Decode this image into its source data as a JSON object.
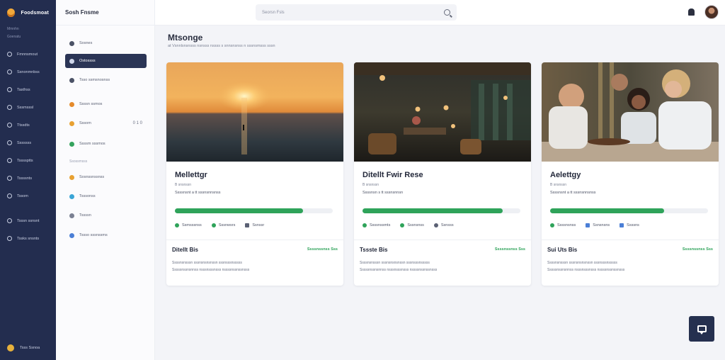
{
  "rail": {
    "brand": "Foodsmoat",
    "sub_lines": [
      "Mmnhn",
      "Goenatu"
    ],
    "items": [
      "Fmnnsmout",
      "Ssnonmnbss",
      "Tasthss",
      "Sssmsssl",
      "Ttssdts",
      "Sssssss",
      "Tssssptts",
      "Tssssnts",
      "Tssom",
      "Tsssn ssnsnt",
      "Tssks snsnts"
    ],
    "bottom": "Tsss Ssnoa"
  },
  "side": {
    "title": "Sosh Fnsme",
    "items": [
      {
        "label": "Sosnes",
        "color": "#4b5266"
      },
      {
        "label": "Ostossss",
        "color": "#cfd6ea",
        "active": true
      },
      {
        "label": "Tsso ssmsnosnss",
        "color": "#4b5266"
      },
      {
        "label": "Ssssn ssmos",
        "color": "#e58a2b"
      },
      {
        "label": "Sssom",
        "color": "#e8a132",
        "count": "0 1 0"
      },
      {
        "label": "Ssssm sssmos",
        "color": "#35a35e"
      }
    ],
    "section": "Ssossmsss",
    "section_items": [
      {
        "label": "Sosnssnssnss",
        "color": "#e8a132"
      },
      {
        "label": "Tsssonss",
        "color": "#3aa5d6"
      },
      {
        "label": "Tssssn",
        "color": "#7b8193"
      },
      {
        "label": "Tssso sssnssms",
        "color": "#4b7fd6"
      }
    ]
  },
  "topbar": {
    "search_placeholder": "Seorsn Fsls"
  },
  "main": {
    "heading": "Mtsonge",
    "subheading": "at Vsnnlsnsnsss nsnsss nssss s  snnsnsnss n sssnsmsss sssn"
  },
  "cards": [
    {
      "name": "Mellettgr",
      "line1": "B snsnssn",
      "line2": "Ssssnsnt a tt sssnsnnsnss",
      "progress": 0.81,
      "tags": [
        {
          "label": "Ssmsssnss",
          "color": "#2fa35a"
        },
        {
          "label": "Sssnwsrs",
          "color": "#2fa35a"
        },
        {
          "label": "Ssnssr",
          "color": "#5b6174"
        }
      ],
      "foot_title": "Ditellt Bis",
      "foot_status": "Ssssnssnss  Sss",
      "foot_line1": "Ssssnsnsssn sssnsnsnsnssn sssnsssnsssss",
      "foot_line2": "Sssssnssnsnnss nsssnsssnsss nssssnssnssnsss"
    },
    {
      "name": "Ditellt Fwir Rese",
      "line1": "B snsnssn",
      "line2": "Ssssnsn s tt sssnsnnsn",
      "progress": 0.89,
      "tags": [
        {
          "label": "Ssssnssmts",
          "color": "#2fa35a"
        },
        {
          "label": "Sssnsnss",
          "color": "#2fa35a"
        },
        {
          "label": "Ssnsss",
          "color": "#5b6174"
        }
      ],
      "foot_title": "Tssste Bis",
      "foot_status": "Ssssnssnss  Sss",
      "foot_line1": "Ssssnsnsssn sssnsnsnsnssn sssnsssnsssss",
      "foot_line2": "Sssssnssnsnnss nsssnsssnsss nssssnssnssnsss"
    },
    {
      "name": "Aelettgy",
      "line1": "B snsnssn",
      "line2": "Ssssnsnt a tt sssnsnnsnss",
      "progress": 0.72,
      "tags": [
        {
          "label": "Ssssnsnss",
          "color": "#2fa35a"
        },
        {
          "label": "Ssnsnsns",
          "color": "#4b7fd6"
        },
        {
          "label": "Ssssns",
          "color": "#4b7fd6"
        }
      ],
      "foot_title": "Sui Uts Bis",
      "foot_status": "Ssssnssnss  Sss",
      "foot_line1": "Ssssnsnsssn sssnsnsnsnssn sssnsssnsssss",
      "foot_line2": "Sssssnssnsnnss nsssnsssnsss nssssnssnssnsss"
    }
  ]
}
